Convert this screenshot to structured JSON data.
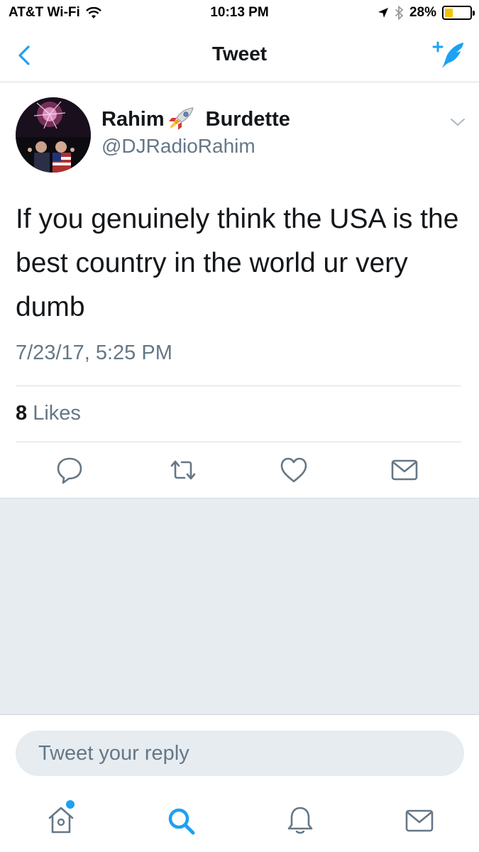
{
  "status_bar": {
    "carrier": "AT&T Wi-Fi",
    "time": "10:13 PM",
    "battery_percent": "28%",
    "battery_level": 0.28,
    "icons": [
      "wifi-icon",
      "location-arrow-icon",
      "bluetooth-icon",
      "battery-icon"
    ]
  },
  "nav": {
    "title": "Tweet",
    "back_icon": "chevron-left-icon",
    "compose_icon": "compose-tweet-icon"
  },
  "tweet": {
    "display_name_first": "Rahim",
    "display_name_emoji": "rocket-emoji",
    "display_name_last": "Burdette",
    "handle": "@DJRadioRahim",
    "text": "If you genuinely think the USA is the best country in the world ur very dumb",
    "timestamp": "7/23/17, 5:25 PM",
    "likes_count": "8",
    "likes_label": "Likes"
  },
  "actions": [
    "reply-icon",
    "retweet-icon",
    "like-icon",
    "direct-message-icon"
  ],
  "reply_box": {
    "placeholder": "Tweet your reply"
  },
  "tabs": [
    "home-icon",
    "search-icon",
    "notifications-icon",
    "messages-icon"
  ],
  "colors": {
    "accent": "#1da1f2",
    "text_primary": "#14171a",
    "text_secondary": "#657786",
    "background_gray": "#e6ecf0",
    "battery_fill": "#f5c400"
  }
}
